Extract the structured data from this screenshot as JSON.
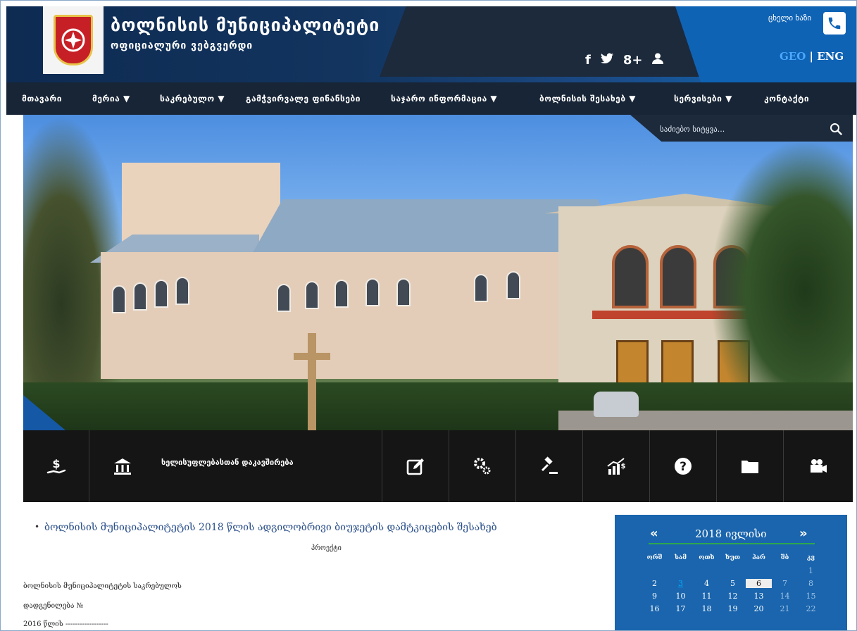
{
  "header": {
    "title": "ბოლნისის მუნიციპალიტეტი",
    "subtitle": "ოფიციალური ვებგვერდი",
    "hotline_label": "ცხელი ხაზი",
    "lang_geo": "GEO",
    "lang_sep": " | ",
    "lang_eng": "ENG",
    "social": [
      "f",
      "🐦",
      "8+",
      "👤"
    ]
  },
  "nav": {
    "items": [
      {
        "label": "მთავარი"
      },
      {
        "label": "მერია ▼"
      },
      {
        "label": "საკრებულო ▼"
      },
      {
        "label": "გამჭვირვალე ფინანსები"
      },
      {
        "label": "საჯარო ინფორმაცია ▼"
      },
      {
        "label": "ბოლნისის შესახებ ▼"
      },
      {
        "label": "სერვისები ▼"
      },
      {
        "label": "კონტაქტი"
      }
    ]
  },
  "search": {
    "placeholder": "საძიებო სიტყვა..."
  },
  "services": {
    "feature_label": "ხელისუფლებასთან დაკავშირება"
  },
  "content": {
    "news_title": "ბოლნისის მუნიციპალიტეტის 2018 წლის ადგილობრივი ბიუჯეტის დამტკიცების შესახებ",
    "project_label": "პროექტი",
    "doc_line_1": "ბოლნისის მუნიციპალიტეტის საკრებულოს",
    "doc_line_2": "დადგენილება №",
    "doc_line_3": "2016 წლის ------------------"
  },
  "calendar": {
    "prev": "«",
    "next": "»",
    "title": "2018 ივლისი",
    "weekdays": [
      "ორშ",
      "სამ",
      "ოთხ",
      "ხუთ",
      "პარ",
      "შბ",
      "კვ"
    ],
    "weeks": [
      [
        "",
        "",
        "",
        "",
        "",
        "",
        "1"
      ],
      [
        "2",
        "3",
        "4",
        "5",
        "6",
        "7",
        "8"
      ],
      [
        "9",
        "10",
        "11",
        "12",
        "13",
        "14",
        "15"
      ],
      [
        "16",
        "17",
        "18",
        "19",
        "20",
        "21",
        "22"
      ]
    ]
  }
}
